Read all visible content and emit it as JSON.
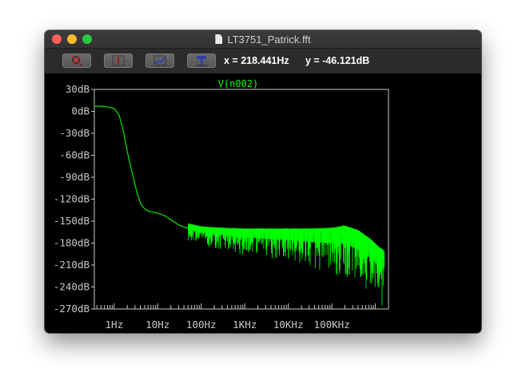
{
  "window": {
    "title": "LT3751_Patrick.fft"
  },
  "toolbar": {
    "buttons": [
      {
        "name": "zoom-reset-button",
        "icon": "magnifier-cross-icon"
      },
      {
        "name": "autorange-y-button",
        "icon": "autorange-vertical-icon"
      },
      {
        "name": "zoom-area-button",
        "icon": "zoom-area-icon"
      },
      {
        "name": "pick-trace-button",
        "icon": "hammer-probe-icon"
      }
    ],
    "cursor_x": "x = 218.441Hz",
    "cursor_y": "y = -46.121dB"
  },
  "colors": {
    "trace": "#00ff00",
    "axis": "#c8c8c8",
    "background": "#000000"
  },
  "chart_data": {
    "type": "line",
    "title": "V(n002)",
    "xscale": "log",
    "xlim": [
      0.35,
      2000000
    ],
    "ylim": [
      -270,
      30
    ],
    "x_tick_labels": [
      "1Hz",
      "10Hz",
      "100Hz",
      "1KHz",
      "10KHz",
      "100KHz"
    ],
    "x_ticks": [
      1,
      10,
      100,
      1000,
      10000,
      100000
    ],
    "y_tick_labels": [
      "30dB",
      "0dB",
      "-30dB",
      "-60dB",
      "-90dB",
      "-120dB",
      "-150dB",
      "-180dB",
      "-210dB",
      "-240dB",
      "-270dB"
    ],
    "y_ticks": [
      30,
      0,
      -30,
      -60,
      -90,
      -120,
      -150,
      -180,
      -210,
      -240,
      -270
    ],
    "series": [
      {
        "x": [
          0.35,
          0.5,
          0.7,
          1.0,
          1.3,
          1.6,
          2.0,
          2.5,
          3.0,
          3.5,
          4.0,
          4.5,
          5.0,
          5.5,
          6.0,
          7.0,
          8.0,
          10,
          15,
          20,
          30,
          50
        ],
        "y": [
          7,
          7,
          6,
          4,
          -5,
          -25,
          -55,
          -80,
          -100,
          -115,
          -125,
          -130,
          -133,
          -135,
          -136,
          -137,
          -138,
          -139,
          -143,
          -148,
          -155,
          -160
        ]
      }
    ],
    "noise_band": {
      "x": [
        50,
        100,
        300,
        1000,
        3000,
        10000,
        30000,
        100000,
        200000,
        400000,
        800000,
        1200000,
        1600000
      ],
      "upper": [
        -153,
        -157,
        -159,
        -160,
        -160,
        -160,
        -160,
        -159,
        -156,
        -162,
        -175,
        -185,
        -190
      ],
      "lower": [
        -175,
        -182,
        -188,
        -195,
        -200,
        -205,
        -212,
        -220,
        -228,
        -238,
        -250,
        -260,
        -268
      ]
    }
  }
}
